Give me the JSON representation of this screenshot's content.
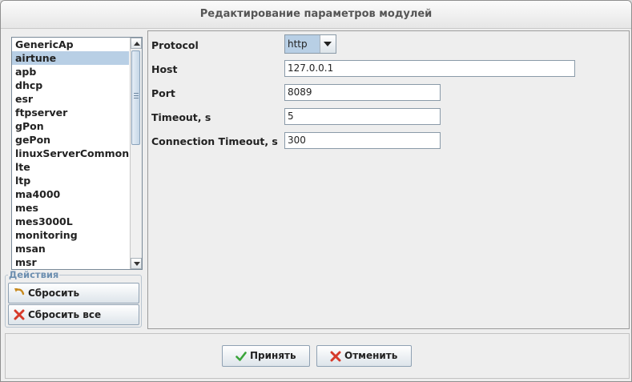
{
  "window": {
    "title": "Редактирование параметров модулей"
  },
  "modules": {
    "items": [
      "GenericAp",
      "airtune",
      "apb",
      "dhcp",
      "esr",
      "ftpserver",
      "gPon",
      "gePon",
      "linuxServerCommon",
      "lte",
      "ltp",
      "ma4000",
      "mes",
      "mes3000L",
      "monitoring",
      "msan",
      "msr"
    ],
    "selected": "airtune"
  },
  "actions": {
    "legend": "Действия",
    "reset_label": "Сбросить",
    "reset_all_label": "Сбросить все"
  },
  "settings": {
    "protocol": {
      "label": "Protocol",
      "value": "http"
    },
    "host": {
      "label": "Host",
      "value": "127.0.0.1"
    },
    "port": {
      "label": "Port",
      "value": "8089"
    },
    "timeout": {
      "label": "Timeout, s",
      "value": "5"
    },
    "connection_timeout": {
      "label": "Connection Timeout, s",
      "value": "300"
    }
  },
  "dialog_buttons": {
    "accept_label": "Принять",
    "cancel_label": "Отменить"
  },
  "icons": {
    "reset": "undo-arrow-icon",
    "reset_all": "red-x-icon",
    "accept": "green-check-icon",
    "cancel": "red-x-icon"
  },
  "colors": {
    "selection": "#b8cfe5",
    "legend": "#6d8fb0",
    "accept_icon": "#3aa53a",
    "cancel_icon": "#d63a2a",
    "reset_icon": "#c7891d"
  }
}
